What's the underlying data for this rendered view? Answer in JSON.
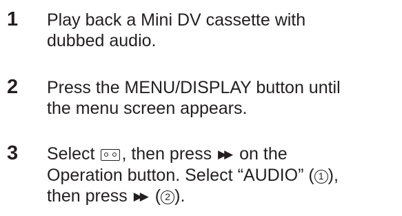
{
  "steps": [
    {
      "number": "1",
      "lines": [
        "Play back a Mini DV cassette with",
        "dubbed audio."
      ]
    },
    {
      "number": "2",
      "lines": [
        "Press the MENU/DISPLAY button until",
        "the menu screen appears."
      ]
    },
    {
      "number": "3",
      "line1_prefix": "Select ",
      "line1_mid": ", then press ",
      "line1_suffix": " on the",
      "line2_prefix": "Operation button. Select “AUDIO” (",
      "line2_circled": "1",
      "line2_suffix": "),",
      "line3_prefix": "then press ",
      "line3_open": " (",
      "line3_circled": "2",
      "line3_suffix": ").",
      "tape_icon": "tape-cassette-icon",
      "ff_icon": "fast-forward-icon",
      "ff_glyph": "▶▶"
    }
  ]
}
